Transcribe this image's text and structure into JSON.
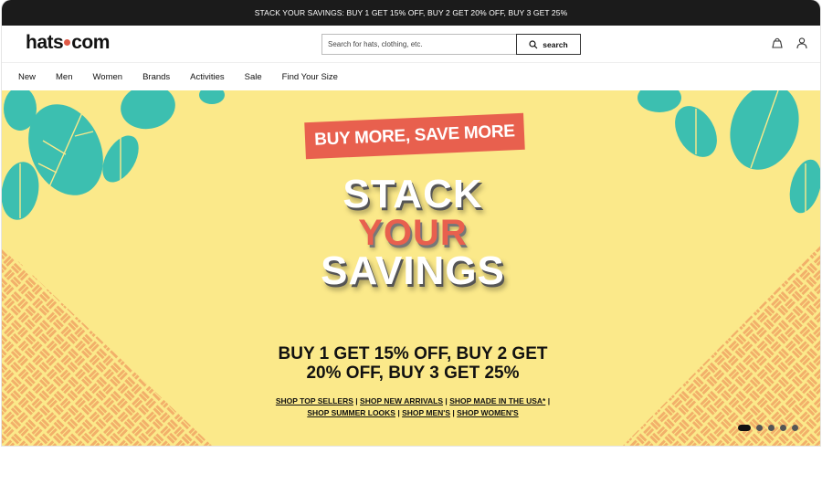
{
  "promo_bar": {
    "text": "STACK YOUR SAVINGS: BUY 1 GET 15% OFF, BUY 2 GET 20% OFF, BUY 3 GET 25%"
  },
  "header": {
    "logo": {
      "part1": "hats",
      "part2": "com"
    },
    "search": {
      "placeholder": "Search for hats, clothing, etc.",
      "value": "",
      "button_label": "search",
      "button_icon": "search-icon"
    },
    "icons": [
      "bag-icon",
      "account-icon"
    ]
  },
  "nav": {
    "items": [
      "New",
      "Men",
      "Women",
      "Brands",
      "Activities",
      "Sale",
      "Find Your Size"
    ]
  },
  "hero": {
    "badge": "BUY MORE, SAVE MORE",
    "headline": {
      "line1": "STACK",
      "line2": "YOUR",
      "line3": "SAVINGS"
    },
    "offer": {
      "line1": "BUY 1 GET 15% OFF, BUY 2 GET",
      "line2": "20% OFF, BUY 3 GET 25%"
    },
    "links": [
      "SHOP TOP SELLERS",
      "SHOP NEW ARRIVALS",
      "SHOP MADE IN THE USA*",
      "SHOP SUMMER LOOKS",
      "SHOP MEN'S",
      "SHOP WOMEN'S"
    ],
    "separator": "|",
    "carousel": {
      "slides": 5,
      "active": 1
    },
    "colors": {
      "background": "#fbe98a",
      "accent": "#e8604e",
      "leaf": "#3cbfb0",
      "pattern": "#f2b06a"
    }
  }
}
